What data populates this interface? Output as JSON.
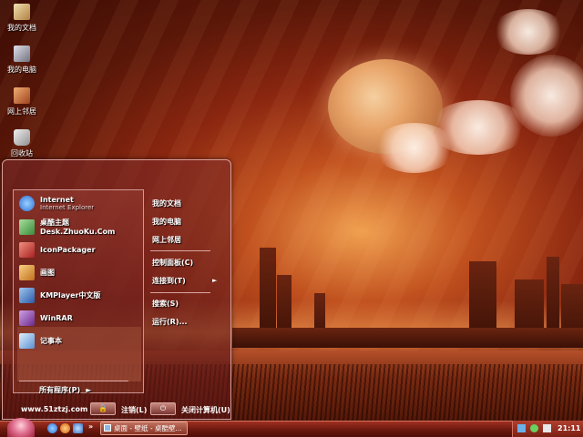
{
  "desktop": {
    "icons": [
      {
        "label": "我的文档",
        "icon": "documents-folder-icon"
      },
      {
        "label": "我的电脑",
        "icon": "computer-icon"
      },
      {
        "label": "网上邻居",
        "icon": "network-icon"
      },
      {
        "label": "回收站",
        "icon": "recycle-bin-icon"
      }
    ]
  },
  "start_menu": {
    "pinned": [
      {
        "title": "Internet",
        "subtitle": "Internet Explorer",
        "icon": "internet-explorer-icon",
        "color": "#2a6fd6"
      },
      {
        "title": "桌酷主题Desk.ZhuoKu.Com",
        "icon": "theme-icon",
        "color": "#4aa04a"
      },
      {
        "title": "IconPackager",
        "icon": "iconpackager-icon",
        "color": "#c8403c"
      },
      {
        "title": "画图",
        "icon": "paint-icon",
        "color": "#e0a040"
      },
      {
        "title": "KMPlayer中文版",
        "icon": "kmplayer-icon",
        "color": "#3a7ad0"
      },
      {
        "title": "WinRAR",
        "icon": "winrar-icon",
        "color": "#8a3aa0"
      },
      {
        "title": "记事本",
        "icon": "notepad-icon",
        "color": "#70a8e8"
      }
    ],
    "all_programs": "所有程序(P)",
    "right_column": [
      {
        "label": "我的文档"
      },
      {
        "label": "我的电脑"
      },
      {
        "label": "网上邻居"
      },
      {
        "label": "控制面板(C)"
      },
      {
        "label": "连接到(T)",
        "has_submenu": true
      },
      {
        "label": "搜索(S)"
      },
      {
        "label": "运行(R)..."
      }
    ],
    "footer": {
      "site": "www.51ztzj.com",
      "logoff": "注销(L)",
      "shutdown": "关闭计算机(U)"
    }
  },
  "taskbar": {
    "quick_launch": [
      "internet-explorer-icon",
      "media-player-icon",
      "desktop-icon",
      "messenger-icon"
    ],
    "task_button": "桌面 - 壁纸 - 桌酷壁...",
    "clock": "21:11"
  },
  "colors": {
    "taskbar": "#7a1e12",
    "menu_border": "#d9a0a0",
    "start_orb": "#e07090"
  }
}
